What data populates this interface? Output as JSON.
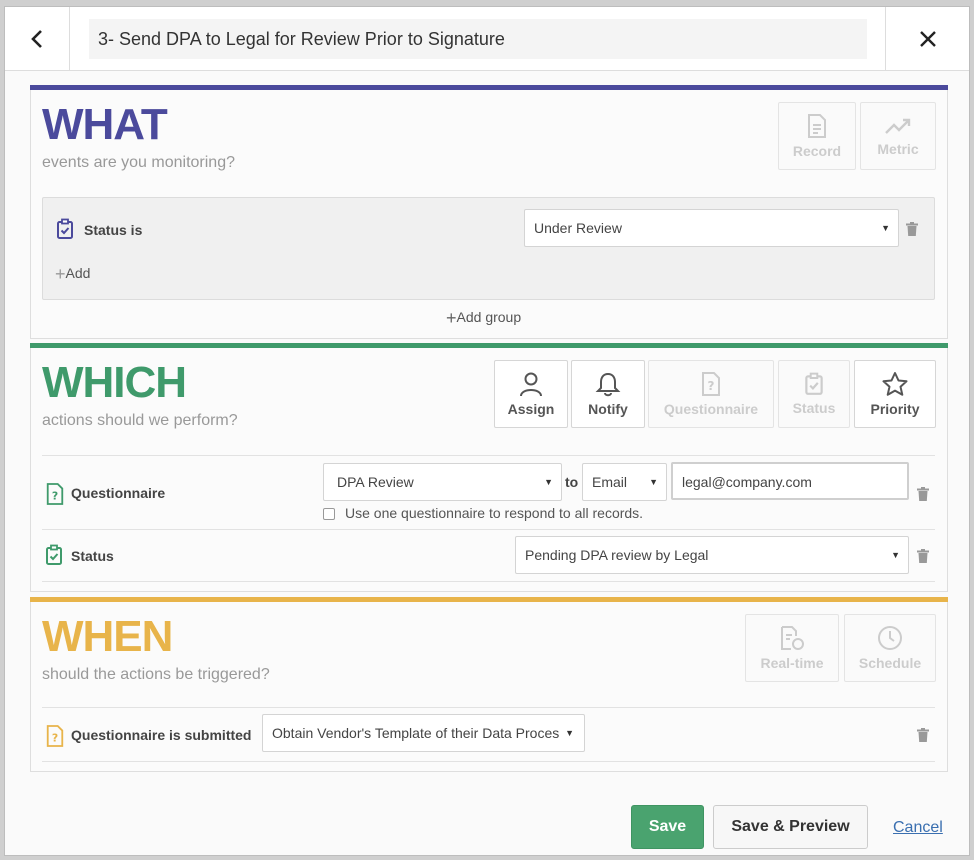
{
  "header": {
    "title": "3- Send DPA to Legal for Review Prior to Signature"
  },
  "colors": {
    "what": "#4b4a9c",
    "which": "#3f9a6b",
    "when": "#e8b44a",
    "save": "#4aa36f",
    "link": "#3a6fb0"
  },
  "what": {
    "heading": "WHAT",
    "subheading": "events are you monitoring?",
    "tiles": [
      {
        "label": "Record",
        "icon": "document-icon",
        "enabled": false
      },
      {
        "label": "Metric",
        "icon": "trend-icon",
        "enabled": false
      }
    ],
    "condition": {
      "label": "Status is",
      "value": "Under Review"
    },
    "add_label": "Add",
    "add_group_label": "Add group"
  },
  "which": {
    "heading": "WHICH",
    "subheading": "actions should we perform?",
    "tiles": [
      {
        "label": "Assign",
        "icon": "user-icon",
        "enabled": true
      },
      {
        "label": "Notify",
        "icon": "bell-icon",
        "enabled": true
      },
      {
        "label": "Questionnaire",
        "icon": "questionnaire-icon",
        "enabled": false
      },
      {
        "label": "Status",
        "icon": "clipboard-check-icon",
        "enabled": false
      },
      {
        "label": "Priority",
        "icon": "star-icon",
        "enabled": true
      }
    ],
    "questionnaire_action": {
      "label": "Questionnaire",
      "value": "DPA Review",
      "to_label": "to",
      "channel": "Email",
      "email": "legal@company.com",
      "checkbox_label": "Use one questionnaire to respond to all records."
    },
    "status_action": {
      "label": "Status",
      "value": "Pending DPA review by Legal"
    }
  },
  "when": {
    "heading": "WHEN",
    "subheading": "should the actions be triggered?",
    "tiles": [
      {
        "label": "Real-time",
        "icon": "realtime-icon",
        "enabled": false
      },
      {
        "label": "Schedule",
        "icon": "clock-icon",
        "enabled": false
      }
    ],
    "trigger": {
      "label": "Questionnaire is submitted",
      "value": "Obtain Vendor's Template of their Data Proces"
    }
  },
  "footer": {
    "save": "Save",
    "save_preview": "Save & Preview",
    "cancel": "Cancel"
  }
}
